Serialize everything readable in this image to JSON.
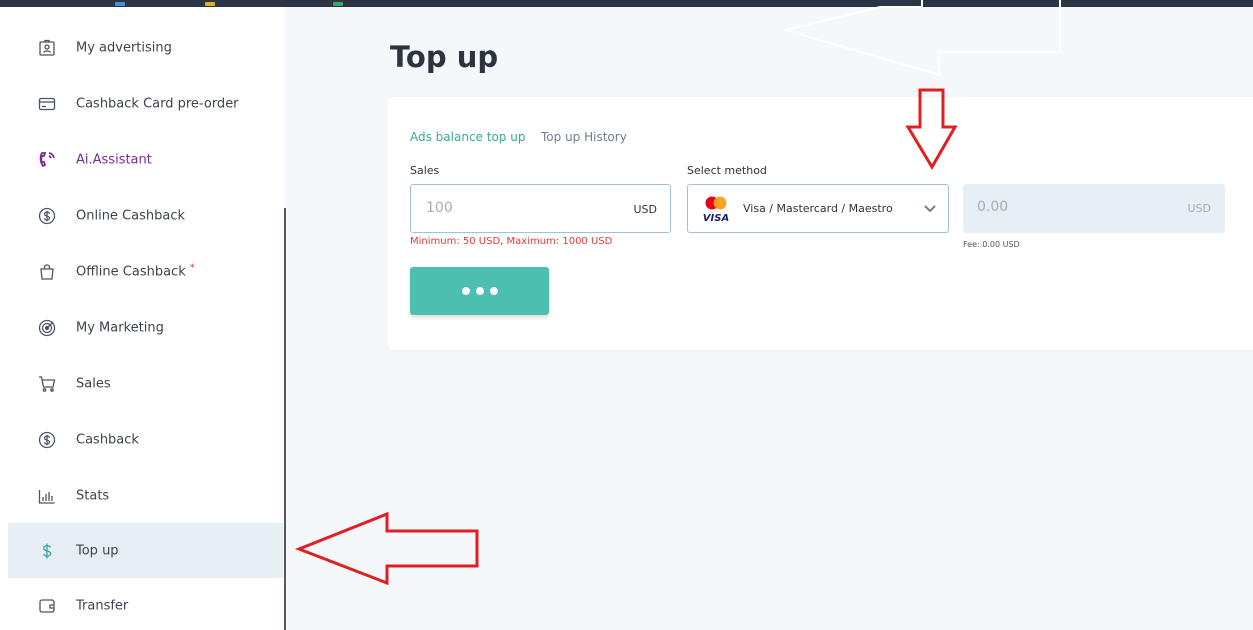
{
  "sidebar": {
    "items": [
      {
        "label": "My advertising",
        "icon": "id-badge-icon"
      },
      {
        "label": "Cashback Card pre-order",
        "icon": "credit-card-icon"
      },
      {
        "label": "Ai.Assistant",
        "icon": "phone-call-icon"
      },
      {
        "label": "Online Cashback",
        "icon": "dollar-circle-icon"
      },
      {
        "label": "Offline Cashback",
        "icon": "shopping-bag-icon",
        "badge": "*"
      },
      {
        "label": "My Marketing",
        "icon": "target-icon"
      },
      {
        "label": "Sales",
        "icon": "cart-icon"
      },
      {
        "label": "Cashback",
        "icon": "dollar-circle-icon"
      },
      {
        "label": "Stats",
        "icon": "bar-chart-icon"
      },
      {
        "label": "Top up",
        "icon": "dollar-icon",
        "active": true
      },
      {
        "label": "Transfer",
        "icon": "wallet-icon"
      }
    ]
  },
  "main": {
    "title": "Top up",
    "tabs": [
      {
        "label": "Ads balance top up",
        "active": true
      },
      {
        "label": "Top up History",
        "active": false
      }
    ],
    "amount": {
      "label": "Sales",
      "placeholder": "100",
      "currency": "USD",
      "hint": "Minimum: 50 USD, Maximum: 1000 USD"
    },
    "method": {
      "label": "Select method",
      "value": "Visa / Mastercard / Maestro"
    },
    "total": {
      "value": "0.00",
      "currency": "USD",
      "fee": "Fee: 0.00 USD"
    },
    "submit_icon": "ellipsis-icon"
  },
  "colors": {
    "accent": "#4cbfb0",
    "tab_active": "#3aa89a",
    "error": "#e53935",
    "annotation": "#e02020",
    "sidebar_active_bg": "#e8eff4"
  }
}
